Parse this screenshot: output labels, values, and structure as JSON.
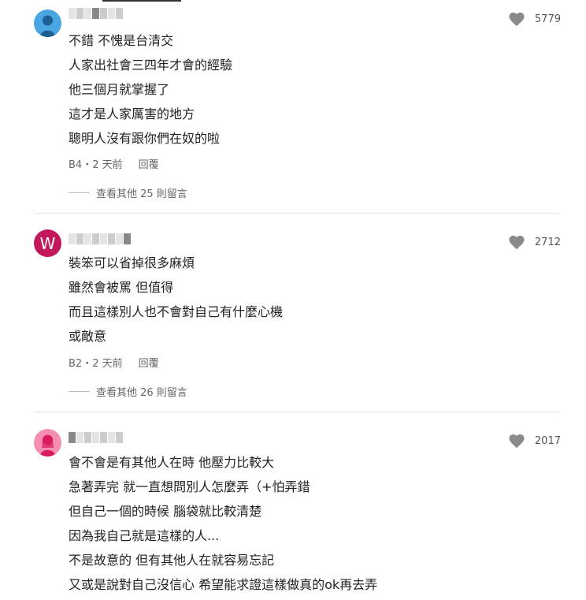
{
  "comments": [
    {
      "avatar_type": "person-blue",
      "likes": "5779",
      "lines": [
        "不錯  不愧是台清交",
        "人家出社會三四年才會的經驗",
        "他三個月就掌握了",
        "這才是人家厲害的地方",
        "聰明人沒有跟你們在奴的啦"
      ],
      "floor_time": "B4・2 天前",
      "reply_label": "回覆",
      "more_replies": "查看其他 25 則留言"
    },
    {
      "avatar_type": "letter",
      "avatar_letter": "W",
      "likes": "2712",
      "lines": [
        "裝笨可以省掉很多麻煩",
        "雖然會被罵 但值得",
        "而且這樣別人也不會對自己有什麼心機",
        "或敵意"
      ],
      "floor_time": "B2・2 天前",
      "reply_label": "回覆",
      "more_replies": "查看其他 26 則留言"
    },
    {
      "avatar_type": "person-pink",
      "likes": "2017",
      "lines": [
        "會不會是有其他人在時 他壓力比較大",
        "急著弄完 就一直想問別人怎麼弄（+怕弄錯",
        "但自己一個的時候 腦袋就比較清楚",
        "因為我自己就是這樣的人...",
        "不是故意的 但有其他人在就容易忘記",
        "又或是說對自己沒信心 希望能求證這樣做真的ok再去弄"
      ]
    }
  ],
  "colors": {
    "heart": "#8a8a8a",
    "avatar_blue": "#4aa6e3",
    "avatar_w": "#c2185b",
    "avatar_pink": "#f48fb1"
  }
}
